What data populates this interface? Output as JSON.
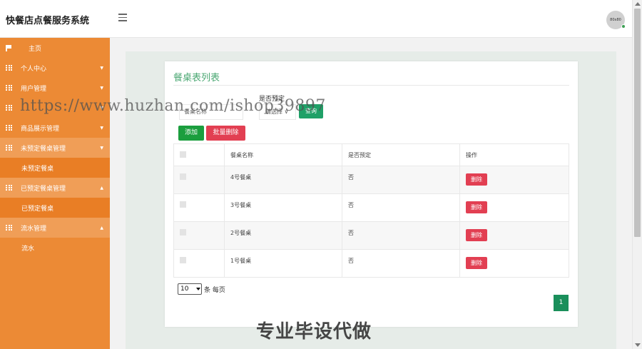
{
  "header": {
    "app_title": "快餐店点餐服务系统",
    "avatar_text": "80x80"
  },
  "sidebar": {
    "items": [
      {
        "label": "主页",
        "icon": "flag-icon",
        "caret": ""
      },
      {
        "label": "个人中心",
        "icon": "grid-icon",
        "caret": "▼"
      },
      {
        "label": "用户管理",
        "icon": "grid-icon",
        "caret": "▼"
      },
      {
        "label": "",
        "icon": "grid-icon",
        "caret": "▼"
      },
      {
        "label": "商品展示管理",
        "icon": "grid-icon",
        "caret": "▼"
      },
      {
        "label": "未预定餐桌管理",
        "icon": "grid-icon",
        "caret": "▼"
      },
      {
        "label": "未预定餐桌",
        "icon": "",
        "caret": ""
      },
      {
        "label": "已预定餐桌管理",
        "icon": "grid-icon",
        "caret": "▲"
      },
      {
        "label": "已预定餐桌",
        "icon": "",
        "caret": ""
      },
      {
        "label": "流水管理",
        "icon": "grid-icon",
        "caret": "▲"
      },
      {
        "label": "流水",
        "icon": "",
        "caret": ""
      }
    ]
  },
  "main": {
    "title": "餐桌表列表",
    "search": {
      "name_label": "餐桌名称",
      "name_placeholder": "餐桌名称",
      "reserved_label": "是否预定",
      "reserved_select": "请选择 ∨",
      "search_button": "查询"
    },
    "actions": {
      "add": "添加",
      "batch_delete": "批量删除"
    },
    "table": {
      "headers": [
        "",
        "餐桌名称",
        "是否预定",
        "操作"
      ],
      "rows": [
        {
          "name": "4号餐桌",
          "reserved": "否",
          "action": "删除"
        },
        {
          "name": "3号餐桌",
          "reserved": "否",
          "action": "删除"
        },
        {
          "name": "2号餐桌",
          "reserved": "否",
          "action": "删除"
        },
        {
          "name": "1号餐桌",
          "reserved": "否",
          "action": "删除"
        }
      ]
    },
    "pager": {
      "page_size": "10",
      "page_size_suffix": "条 每页",
      "current_page": "1"
    }
  },
  "overlays": {
    "watermark_url": "https://www.huzhan.com/ishop39897",
    "badge": "专业毕设代做"
  },
  "colors": {
    "sidebar": "#ec8a35",
    "accent_green": "#1fa067",
    "danger_red": "#e23f52",
    "title_green": "#4aa772"
  }
}
